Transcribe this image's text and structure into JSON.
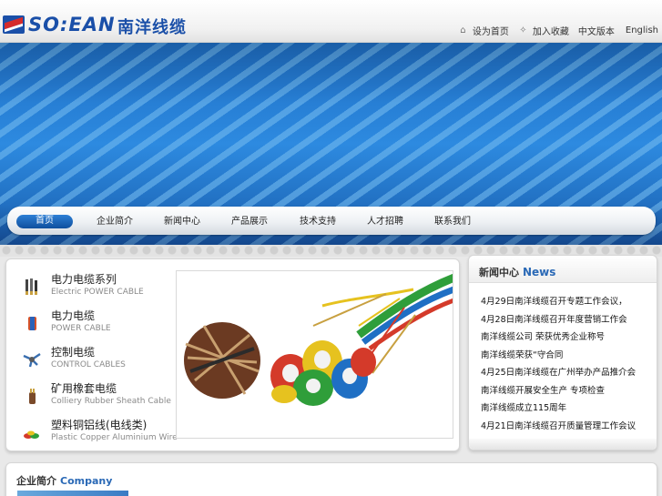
{
  "header": {
    "logo_en": "SO:EAN",
    "logo_cn": "南洋线缆",
    "links": [
      {
        "label": "设为首页",
        "icon": "home-icon"
      },
      {
        "label": "加入收藏",
        "icon": "bookmark-icon"
      },
      {
        "label": "中文版本",
        "icon": ""
      },
      {
        "label": "English",
        "icon": ""
      }
    ]
  },
  "nav": {
    "items": [
      {
        "label": "首页"
      },
      {
        "label": "企业简介"
      },
      {
        "label": "新闻中心"
      },
      {
        "label": "产品展示"
      },
      {
        "label": "技术支持"
      },
      {
        "label": "人才招聘"
      },
      {
        "label": "联系我们"
      }
    ]
  },
  "products": [
    {
      "cn": "电力电缆系列",
      "en": "Electric POWER CABLE",
      "icon": "power-cable-icon"
    },
    {
      "cn": "电力电缆",
      "en": "POWER CABLE",
      "icon": "cable-coil-icon"
    },
    {
      "cn": "控制电缆",
      "en": "CONTROL CABLES",
      "icon": "control-cable-icon"
    },
    {
      "cn": "矿用橡套电缆",
      "en": "Colliery Rubber Sheath Cable",
      "icon": "rubber-cable-icon"
    },
    {
      "cn": "塑料铜铝线(电线类)",
      "en": "Plastic Copper Aluminium Wire",
      "icon": "wire-icon"
    }
  ],
  "news": {
    "title_cn": "新闻中心",
    "title_en": "News",
    "lines": [
      "4月29日南洋线缆召开专题工作会议，",
      "4月28日南洋线缆召开年度营销工作会",
      "南洋线缆公司 荣获优秀企业称号",
      "南洋线缆荣获“守合同",
      "4月25日南洋线缆在广州举办产品推介会",
      "南洋线缆开展安全生产 专项检查",
      "南洋线缆成立115周年",
      "4月21日南洋线缆召开质量管理工作会议"
    ]
  },
  "company": {
    "title_cn": "企业简介",
    "title_en": "Company"
  },
  "colors": {
    "brand_blue": "#1a4fa8",
    "nav_active": "#1f68bd",
    "banner_blue": "#2d8ae0"
  }
}
